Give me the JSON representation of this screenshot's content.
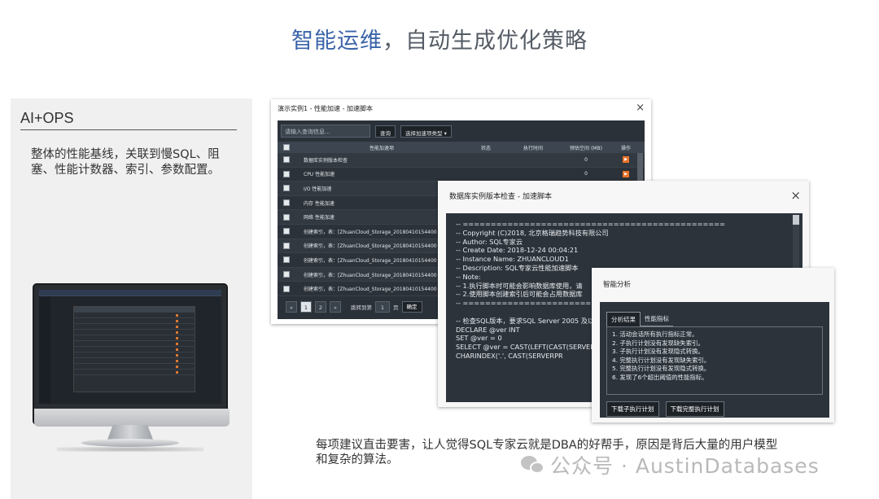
{
  "title": {
    "highlight": "智能运维",
    "rest": "，自动生成优化策略"
  },
  "left": {
    "heading": "AI+OPS",
    "desc": "整体的性能基线，关联到慢SQL、阻塞、性能计数器、索引、参数配置。"
  },
  "window1": {
    "title": "演示实例1 - 性能加速 - 加速脚本",
    "close": "×",
    "search_placeholder": "请输入查询信息...",
    "query_btn": "查询",
    "type_btn": "选择加速项类型 ▾",
    "columns": {
      "name": "性能加速项",
      "status": "状态",
      "time": "执行时间",
      "space": "预估空间 (MB)",
      "op": "操作"
    },
    "rows": [
      {
        "name": "数据库实例版本检查",
        "space": "0"
      },
      {
        "name": "CPU 性能加速",
        "space": "0"
      },
      {
        "name": "I/O 性能加速",
        "space": "0"
      },
      {
        "name": "内存 性能加速",
        "space": ""
      },
      {
        "name": "网络 性能加速",
        "space": ""
      },
      {
        "name": "创建索引，表：[ZhuanCloud_Storage_20180410154400",
        "space": ""
      },
      {
        "name": "创建索引，表：[ZhuanCloud_Storage_20180410154400",
        "space": ""
      },
      {
        "name": "创建索引，表：[ZhuanCloud_Storage_20180410154400",
        "space": ""
      },
      {
        "name": "创建索引，表：[ZhuanCloud_Storage_20180410154400",
        "space": ""
      },
      {
        "name": "创建索引，表：[ZhuanCloud_Storage_20180410154400",
        "space": ""
      }
    ],
    "pager": {
      "prev": "«",
      "p1": "1",
      "p2": "2",
      "next": "»",
      "jump_label": "跳转到第",
      "jump_value": "1",
      "page_unit": "页",
      "go": "确定"
    }
  },
  "window2": {
    "title": "数据库实例版本检查 - 加速脚本",
    "close": "×",
    "lines": [
      "-- ===============================================",
      "-- Copyright (C)2018, 北京格瑞趋势科技有限公司",
      "-- Author:     SQL专家云",
      "-- Create Date: 2018-12-24 00:04:21",
      "-- Instance Name: ZHUANCLOUD1",
      "-- Description: SQL专家云性能加速脚本",
      "-- Note:",
      "--      1.执行脚本时可能会影响数据库使用，请",
      "--      2.使用脚本创建索引后可能会占用数据库",
      "-- ===============================================",
      "",
      "-- 检查SQL版本，要求SQL Server 2005 及以上",
      "DECLARE @ver INT",
      "SET @ver = 0",
      "SELECT  @ver = CAST(LEFT(CAST(SERVERPRO",
      "                    CHARINDEX('.', CAST(SERVERPR"
    ]
  },
  "window3": {
    "title": "智能分析",
    "tabs": [
      "分析结果",
      "性能指标"
    ],
    "items": [
      "1. 活动会话所有执行指标正常。",
      "2. 子执行计划没有发现缺失索引。",
      "3. 子执行计划没有发现隐式转换。",
      "4. 完整执行计划没有发现缺失索引。",
      "5. 完整执行计划没有发现隐式转换。",
      "6. 发现了6个超出阈值的性能指标。"
    ],
    "btn_sub": "下载子执行计划",
    "btn_full": "下载完整执行计划"
  },
  "bottom_desc": "每项建议直击要害，让人觉得SQL专家云就是DBA的好帮手，原因是背后大量的用户模型和复杂的算法。",
  "watermark": "公众号 · AustinDatabases",
  "colors": {
    "accent": "#3a63a8",
    "dark_panel": "#2c333b",
    "op_orange": "#e8742a"
  }
}
